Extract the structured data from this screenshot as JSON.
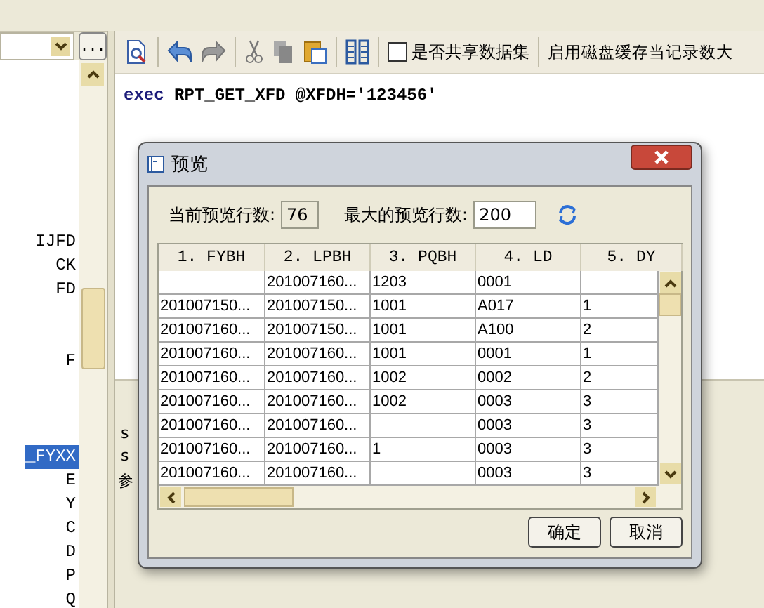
{
  "left_panel": {
    "browse_button": "...",
    "items": [
      {
        "label": "IJFD",
        "selected": false
      },
      {
        "label": "CK",
        "selected": false
      },
      {
        "label": "FD",
        "selected": false
      },
      {
        "label": "F",
        "selected": false
      },
      {
        "label": "_FYXX",
        "selected": true
      },
      {
        "label": "E",
        "selected": false
      },
      {
        "label": "Y",
        "selected": false
      },
      {
        "label": "C",
        "selected": false
      },
      {
        "label": "D",
        "selected": false
      },
      {
        "label": "P",
        "selected": false
      },
      {
        "label": "Q",
        "selected": false
      }
    ]
  },
  "toolbar": {
    "share_checkbox": {
      "label": "是否共享数据集",
      "checked": false
    },
    "cache_label": "启用磁盘缓存当记录数大"
  },
  "editor": {
    "keyword": "exec",
    "statement": "RPT_GET_XFD @XFDH='123456'"
  },
  "bottom_panel": {
    "lines": [
      "s",
      "s"
    ],
    "tab": "参"
  },
  "dialog": {
    "title": "预览",
    "current_rows_label": "当前预览行数:",
    "current_rows": "76",
    "max_rows_label": "最大的预览行数:",
    "max_rows": "200",
    "table": {
      "columns": [
        "1. FYBH",
        "2. LPBH",
        "3. PQBH",
        "4. LD",
        "5. DY"
      ],
      "rows": [
        [
          "",
          "201007160...",
          "1203",
          "0001",
          ""
        ],
        [
          "201007150...",
          "201007150...",
          "1001",
          "A017",
          "1"
        ],
        [
          "201007160...",
          "201007150...",
          "1001",
          "A100",
          "2"
        ],
        [
          "201007160...",
          "201007160...",
          "1001",
          "0001",
          "1"
        ],
        [
          "201007160...",
          "201007160...",
          "1002",
          "0002",
          "2"
        ],
        [
          "201007160...",
          "201007160...",
          "1002",
          "0003",
          "3"
        ],
        [
          "201007160...",
          "201007160...",
          "",
          "0003",
          "3"
        ],
        [
          "201007160...",
          "201007160...",
          "1",
          "0003",
          "3"
        ],
        [
          "201007160...",
          "201007160...",
          "",
          "0003",
          "3"
        ]
      ]
    },
    "buttons": [
      "确定",
      "取消"
    ]
  }
}
